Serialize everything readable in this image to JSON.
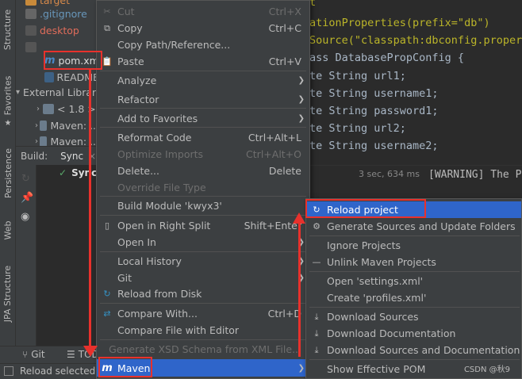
{
  "sidebar": {
    "structure": "Structure",
    "favorites": "Favorites",
    "persistence": "Persistence",
    "web": "Web",
    "jpa": "JPA Structure"
  },
  "tree": {
    "items": [
      {
        "label": "target"
      },
      {
        "label": ".gitignore"
      },
      {
        "label": "desktop"
      },
      {
        "label": ""
      },
      {
        "label": "pom.xml"
      },
      {
        "label": "README"
      },
      {
        "label": "External Libraries"
      },
      {
        "label": "< 1.8 >"
      },
      {
        "label": "Maven: ..."
      },
      {
        "label": "Maven: ..."
      }
    ]
  },
  "build": {
    "tab_build": "Build:",
    "tab_sync": "Sync",
    "sync_label": "Sync:",
    "time": "3 sec, 634 ms",
    "console_text": "[WARNING] The P"
  },
  "editor": {
    "lines": [
      "t",
      "ationProperties(prefix=\"db\")",
      "Source(\"classpath:dbconfig.propert",
      "ass DatabasePropConfig {",
      "te String url1;",
      "te String username1;",
      "te String password1;",
      "te String url2;",
      "te String username2;"
    ]
  },
  "menu": {
    "items": [
      {
        "label": "Cut",
        "shortcut": "Ctrl+X",
        "disabled": true
      },
      {
        "label": "Copy",
        "shortcut": "Ctrl+C"
      },
      {
        "label": "Copy Path/Reference...",
        "shortcut": ""
      },
      {
        "label": "Paste",
        "shortcut": "Ctrl+V"
      },
      {
        "label": "Analyze",
        "shortcut": ""
      },
      {
        "label": "Refactor",
        "shortcut": ""
      },
      {
        "label": "Add to Favorites",
        "shortcut": ""
      },
      {
        "label": "Reformat Code",
        "shortcut": "Ctrl+Alt+L"
      },
      {
        "label": "Optimize Imports",
        "shortcut": "Ctrl+Alt+O",
        "disabled": true
      },
      {
        "label": "Delete...",
        "shortcut": "Delete"
      },
      {
        "label": "Override File Type",
        "shortcut": "",
        "disabled": true
      },
      {
        "label": "Build Module 'kwyx3'",
        "shortcut": ""
      },
      {
        "label": "Open in Right Split",
        "shortcut": "Shift+Enter"
      },
      {
        "label": "Open In",
        "shortcut": ""
      },
      {
        "label": "Local History",
        "shortcut": ""
      },
      {
        "label": "Git",
        "shortcut": ""
      },
      {
        "label": "Reload from Disk",
        "shortcut": ""
      },
      {
        "label": "Compare With...",
        "shortcut": "Ctrl+D"
      },
      {
        "label": "Compare File with Editor",
        "shortcut": ""
      },
      {
        "label": "Generate XSD Schema from XML File...",
        "shortcut": "",
        "disabled": true
      },
      {
        "label": "Maven",
        "shortcut": ""
      }
    ]
  },
  "submenu": {
    "items": [
      {
        "label": "Reload project"
      },
      {
        "label": "Generate Sources and Update Folders"
      },
      {
        "label": "Ignore Projects"
      },
      {
        "label": "Unlink Maven Projects"
      },
      {
        "label": "Open 'settings.xml'"
      },
      {
        "label": "Create 'profiles.xml'"
      },
      {
        "label": "Download Sources"
      },
      {
        "label": "Download Documentation"
      },
      {
        "label": "Download Sources and Documentation"
      },
      {
        "label": "Show Effective POM"
      }
    ]
  },
  "bottom": {
    "git": "Git",
    "todo": "TODO"
  },
  "status": {
    "text": "Reload selected"
  },
  "watermark": "CSDN @秋9",
  "colors": {
    "accent": "#2f65ca",
    "highlight_box": "#e8312c"
  }
}
